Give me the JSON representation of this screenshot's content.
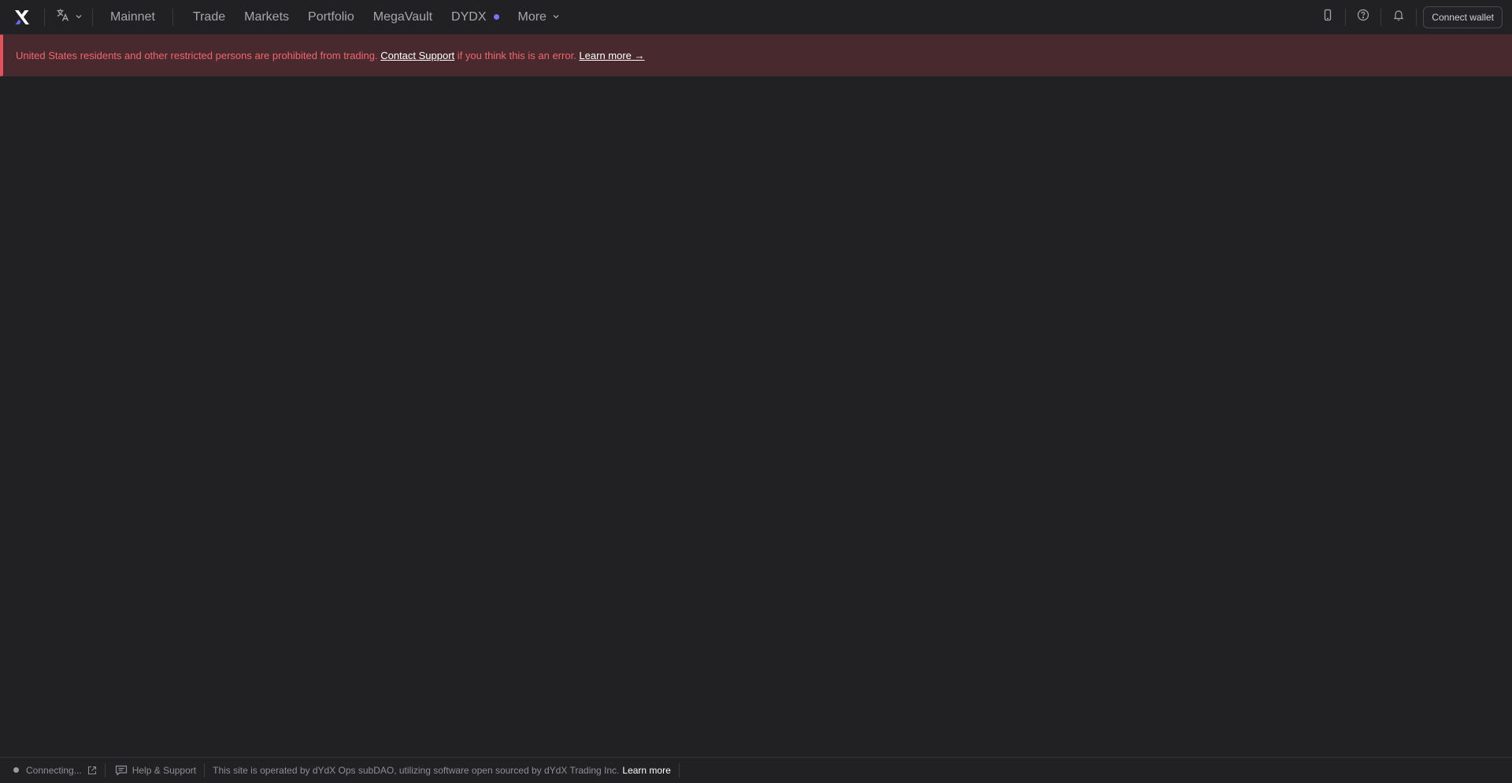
{
  "header": {
    "network": "Mainnet",
    "nav": [
      {
        "label": "Trade"
      },
      {
        "label": "Markets"
      },
      {
        "label": "Portfolio"
      },
      {
        "label": "MegaVault"
      },
      {
        "label": "DYDX"
      },
      {
        "label": "More"
      }
    ],
    "connect_label": "Connect wallet",
    "icons": {
      "logo": "dydx-logo-icon",
      "language": "translate-icon",
      "mobile": "mobile-phone-icon",
      "help": "question-circle-icon",
      "notifications": "bell-icon"
    }
  },
  "banner": {
    "text_before": "United States residents and other restricted persons are prohibited from trading.",
    "link_support": "Contact Support",
    "text_after": "if you think this is an error.",
    "link_learn": "Learn more →"
  },
  "footer": {
    "status": "Connecting...",
    "help": "Help & Support",
    "operated": "This site is operated by dYdX Ops subDAO, utilizing software open sourced by dYdX Trading Inc.",
    "learn_more": "Learn more"
  },
  "colors": {
    "background": "#212124",
    "banner_bg": "#482a2e",
    "banner_accent": "#e2545c",
    "banner_text": "#f0666c",
    "dydx_dot": "#7774ff",
    "logo_accent": "#6966ff"
  }
}
